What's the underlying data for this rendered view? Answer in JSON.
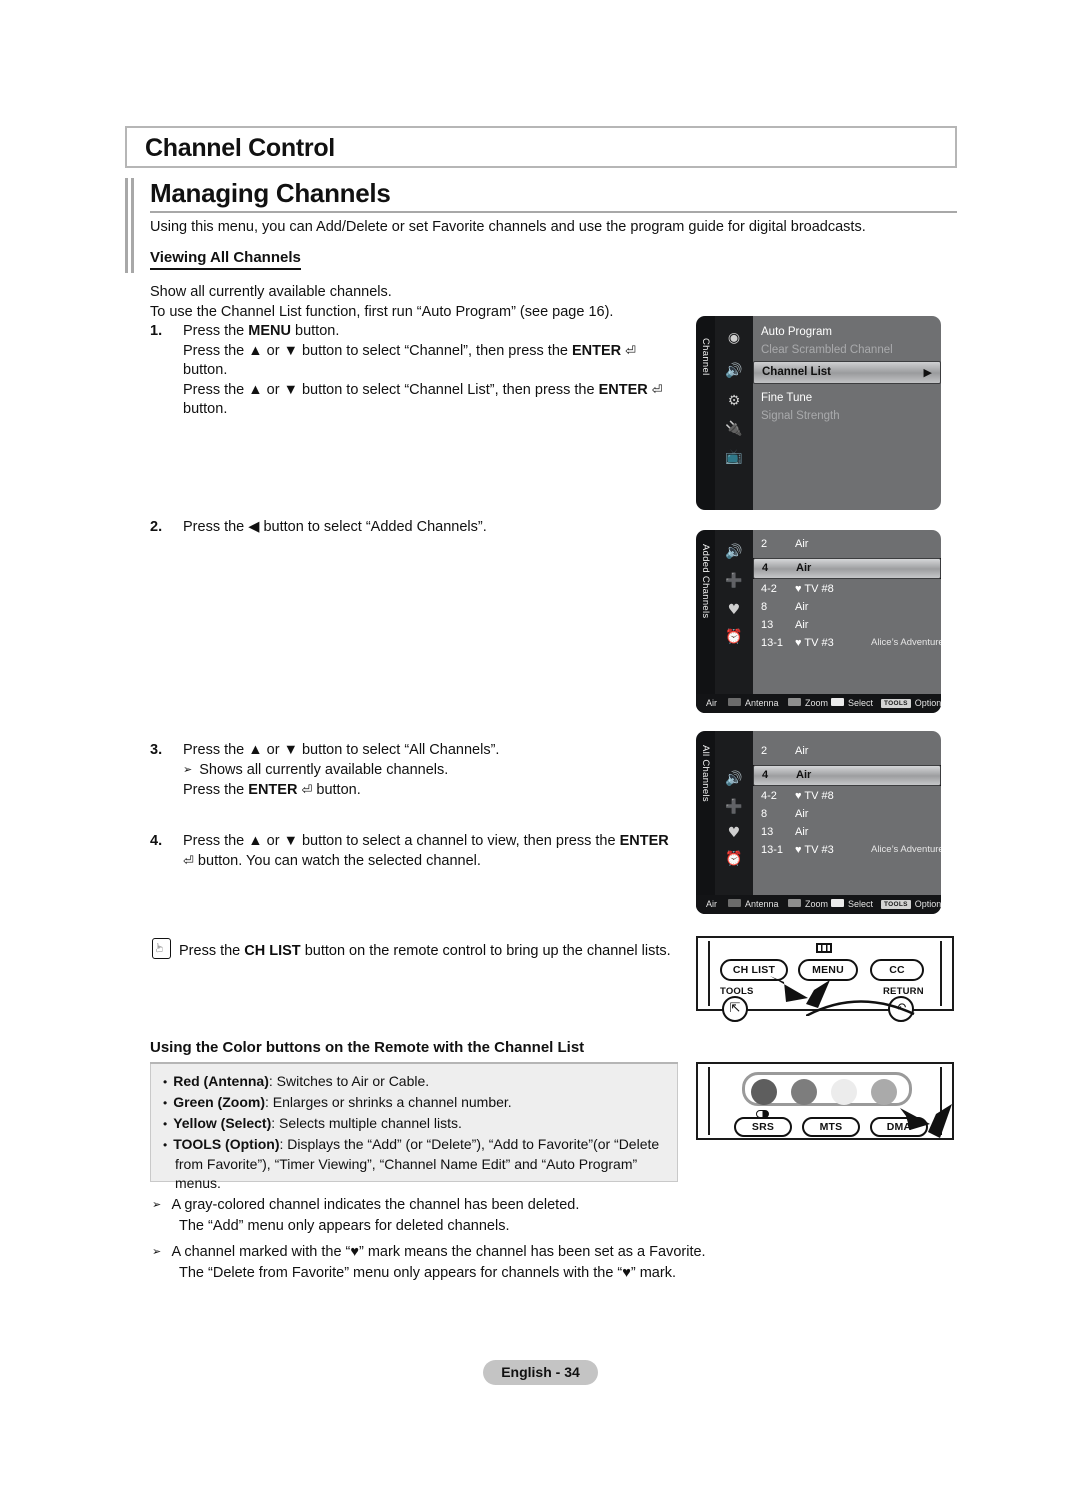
{
  "page": {
    "chapter_title": "Channel Control",
    "section_title": "Managing Channels",
    "section_intro": "Using this menu, you can Add/Delete or set Favorite channels and use the program guide for digital broadcasts.",
    "subheading": "Viewing All Channels",
    "footer": "English - 34"
  },
  "lead": {
    "line1": "Show all currently available channels.",
    "line2": "To use the Channel List function, first run “Auto Program” (see page 16)."
  },
  "steps": [
    {
      "num": "1.",
      "lines": [
        "Press the MENU button.",
        "Press the ▲ or ▼ button to select “Channel”, then press the ENTER ⏎ button.",
        "Press the ▲ or ▼ button to select “Channel List”, then press the ENTER ⏎ button."
      ]
    },
    {
      "num": "2.",
      "lines": [
        "Press the ◀ button to select “Added Channels”."
      ]
    },
    {
      "num": "3.",
      "lines": [
        "Press the ▲ or ▼ button to select “All Channels”.",
        "Shows all currently available channels.",
        "Press the ENTER ⏎ button."
      ]
    },
    {
      "num": "4.",
      "lines": [
        "Press the ▲ or ▼ button to select a channel to view, then press the ENTER ⏎ button. You can watch the selected channel."
      ]
    }
  ],
  "chlist_note": "Press the CH LIST button on the remote control to bring up the channel lists.",
  "color_buttons": {
    "heading": "Using the Color buttons on the Remote with the Channel List",
    "items": [
      {
        "key": "Red (Antenna)",
        "desc": ": Switches to Air or Cable."
      },
      {
        "key": "Green (Zoom)",
        "desc": ": Enlarges or shrinks a channel number."
      },
      {
        "key": "Yellow (Select)",
        "desc": ": Selects multiple channel lists."
      },
      {
        "key": "TOOLS (Option)",
        "desc": ": Displays the “Add” (or “Delete”), “Add to Favorite”(or “Delete from Favorite”), “Timer Viewing”, “Channel Name Edit” and “Auto Program” menus."
      }
    ]
  },
  "bottom_notes": [
    {
      "line1": "A gray-colored channel indicates the channel has been deleted.",
      "line2": "The “Add” menu only appears for deleted channels."
    },
    {
      "line1": "A channel marked with the “♥” mark means the channel has been set as a Favorite.",
      "line2": "The “Delete from Favorite” menu only appears for channels with the “♥” mark."
    }
  ],
  "osd_menu": {
    "rail_label": "Channel",
    "items": [
      {
        "label": "Auto Program",
        "state": "normal"
      },
      {
        "label": "Clear Scrambled Channel",
        "state": "dim"
      },
      {
        "label": "Channel List",
        "state": "selected",
        "arrow": "▶"
      },
      {
        "label": "Fine Tune",
        "state": "normal"
      },
      {
        "label": "Signal Strength",
        "state": "dim"
      }
    ],
    "icons": [
      "antenna-icon",
      "channel-icon",
      "gear-icon",
      "plug-icon",
      "tv-icon"
    ]
  },
  "osd_added": {
    "rail_label": "Added Channels",
    "icons": [
      "all-channels-icon",
      "added-channels-icon",
      "favorites-heart-icon",
      "programmed-icon"
    ],
    "rows": [
      {
        "num": "2",
        "name": "Air",
        "prog": ""
      },
      {
        "num": "4",
        "name": "Air",
        "prog": "",
        "selected": true
      },
      {
        "num": "4-2",
        "name": "♥ TV #8",
        "prog": ""
      },
      {
        "num": "8",
        "name": "Air",
        "prog": ""
      },
      {
        "num": "13",
        "name": "Air",
        "prog": ""
      },
      {
        "num": "13-1",
        "name": "♥ TV #3",
        "prog": "Alice’s Adventures in Wonderland"
      }
    ],
    "footer": {
      "source": "Air",
      "red": "Antenna",
      "green": "Zoom",
      "yellow": "Select",
      "tools_badge": "TOOLS",
      "tools": "Option"
    }
  },
  "osd_all": {
    "rail_label": "All Channels",
    "icons": [
      "all-channels-icon",
      "added-channels-icon",
      "favorites-heart-icon",
      "programmed-icon"
    ],
    "rows": [
      {
        "num": "2",
        "name": "Air",
        "prog": ""
      },
      {
        "num": "4",
        "name": "Air",
        "prog": "",
        "selected": true
      },
      {
        "num": "4-2",
        "name": "♥ TV #8",
        "prog": ""
      },
      {
        "num": "8",
        "name": "Air",
        "prog": ""
      },
      {
        "num": "13",
        "name": "Air",
        "prog": ""
      },
      {
        "num": "13-1",
        "name": "♥ TV #3",
        "prog": "Alice’s Adventures in Wonderland"
      }
    ],
    "footer": {
      "source": "Air",
      "red": "Antenna",
      "green": "Zoom",
      "yellow": "Select",
      "tools_badge": "TOOLS",
      "tools": "Option"
    }
  },
  "remote_top": {
    "buttons": [
      "CH LIST",
      "MENU",
      "CC"
    ],
    "labels": [
      "TOOLS",
      "RETURN"
    ]
  },
  "remote_bottom": {
    "buttons": [
      "SRS",
      "MTS",
      "DMA"
    ],
    "color_dots": [
      "#5e5e5e",
      "#7d7d7d",
      "#ececec",
      "#aaaaaa"
    ]
  },
  "colors": {
    "osd_body": "#6e6f71",
    "osd_rail": "#111214",
    "footer_red": "#6b6b6b",
    "footer_green": "#8e8e8e",
    "footer_yellow": "#ececec",
    "page_rule": "#b6b6b6"
  }
}
